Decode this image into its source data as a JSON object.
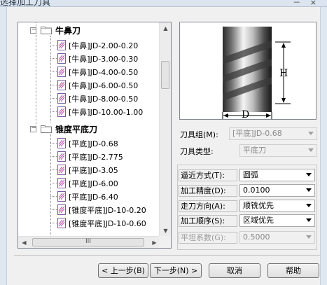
{
  "window": {
    "title": "选择加工刀具",
    "controls": "－ × "
  },
  "tree": {
    "groups": [
      {
        "label": "牛鼻刀",
        "expander": "－",
        "items": [
          "[牛鼻]JD-2.00-0.20",
          "[牛鼻]JD-3.00-0.30",
          "[牛鼻]JD-4.00-0.50",
          "[牛鼻]JD-6.00-0.50",
          "[牛鼻]JD-8.00-0.50",
          "[牛鼻]JD-10.00-1.00"
        ]
      },
      {
        "label": "锥度平底刀",
        "expander": "－",
        "items": [
          "[平底]JD-0.68",
          "[平底]JD-2.775",
          "[平底]JD-3.05",
          "[平底]JD-6.00",
          "[平底]JD-6.40",
          "[锥度平底]JD-10-0.20",
          "[锥度平底]JD-10-0.60"
        ]
      }
    ],
    "hscroll_grip": "III"
  },
  "preview": {
    "label_h": "H",
    "label_d": "D"
  },
  "tool": {
    "group_label": "刀具组(M):",
    "group_value": "[平底]JD-0.68",
    "type_label": "刀具类型:",
    "type_value": "平底刀"
  },
  "params": {
    "approach_label": "逼近方式(T):",
    "approach_value": "圆弧",
    "precision_label": "加工精度(D):",
    "precision_value": "0.0100",
    "direction_label": "走刀方向(A):",
    "direction_value": "顺铣优先",
    "order_label": "加工顺序(S):",
    "order_value": "区域优先",
    "flat_label": "平坦系数(G):",
    "flat_value": "0.5000"
  },
  "buttons": {
    "prev": "< 上一步(B)",
    "next": "下一步(N) >",
    "cancel": "取消",
    "help": "帮助"
  }
}
